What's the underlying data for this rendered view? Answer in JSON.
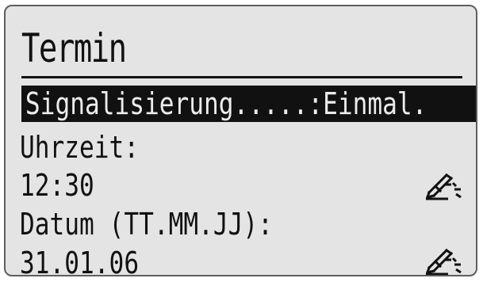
{
  "screen": {
    "title": "Termin"
  },
  "menu": {
    "signalisierung": "Signalisierung.....:Einmal.",
    "uhrzeit_label": "Uhrzeit:",
    "uhrzeit_value": "12:30",
    "datum_label": "Datum (TT.MM.JJ):",
    "datum_value": "31.01.06"
  },
  "icons": {
    "edit": "edit-pencil-icon"
  },
  "colors": {
    "screen_bg": "#e4e4e4",
    "text": "#111111",
    "selection_bg": "#111111",
    "selection_text": "#ececec",
    "border": "#5e5e5e"
  }
}
